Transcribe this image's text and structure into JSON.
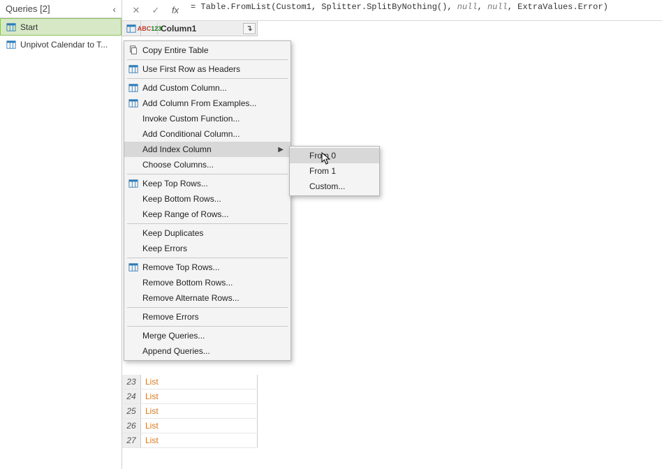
{
  "queries_panel": {
    "header": "Queries [2]",
    "items": [
      {
        "label": "Start",
        "selected": true
      },
      {
        "label": "Unpivot Calendar to T..."
      }
    ]
  },
  "formula_bar": {
    "prefix": "= ",
    "p1": "Table.FromList",
    "paren_open": "(",
    "p2": "Custom1",
    "comma1": ", ",
    "p3": "Splitter.SplitByNothing",
    "paren_oc": "()",
    "comma2": ", ",
    "p4": "null",
    "comma3": ", ",
    "p5": "null",
    "comma4": ", ",
    "p6": "ExtraValues.Error",
    "paren_close": ")"
  },
  "table": {
    "column_header": "Column1",
    "rows": [
      {
        "idx": "23",
        "val": "List"
      },
      {
        "idx": "24",
        "val": "List"
      },
      {
        "idx": "25",
        "val": "List"
      },
      {
        "idx": "26",
        "val": "List"
      },
      {
        "idx": "27",
        "val": "List"
      }
    ]
  },
  "context_menu": {
    "items": [
      {
        "label": "Copy Entire Table",
        "icon": "copy"
      },
      null,
      {
        "label": "Use First Row as Headers",
        "icon": "table"
      },
      null,
      {
        "label": "Add Custom Column...",
        "icon": "table"
      },
      {
        "label": "Add Column From Examples...",
        "icon": "table"
      },
      {
        "label": "Invoke Custom Function..."
      },
      {
        "label": "Add Conditional Column..."
      },
      {
        "label": "Add Index Column",
        "submenu": true,
        "hovered": true
      },
      {
        "label": "Choose Columns..."
      },
      null,
      {
        "label": "Keep Top Rows...",
        "icon": "table"
      },
      {
        "label": "Keep Bottom Rows..."
      },
      {
        "label": "Keep Range of Rows..."
      },
      null,
      {
        "label": "Keep Duplicates"
      },
      {
        "label": "Keep Errors"
      },
      null,
      {
        "label": "Remove Top Rows...",
        "icon": "table"
      },
      {
        "label": "Remove Bottom Rows..."
      },
      {
        "label": "Remove Alternate Rows..."
      },
      null,
      {
        "label": "Remove Errors"
      },
      null,
      {
        "label": "Merge Queries..."
      },
      {
        "label": "Append Queries..."
      }
    ]
  },
  "submenu": {
    "items": [
      {
        "label": "From 0",
        "hovered": true
      },
      {
        "label": "From 1"
      },
      {
        "label": "Custom..."
      }
    ]
  }
}
